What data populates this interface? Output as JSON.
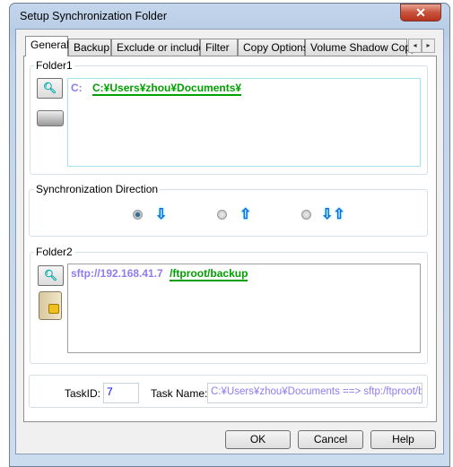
{
  "window": {
    "title": "Setup Synchronization Folder",
    "close_label": "✕"
  },
  "tabs": [
    "General",
    "Backup",
    "Exclude or include",
    "Filter",
    "Copy Options",
    "Volume Shadow Copy"
  ],
  "tab_scroll": {
    "left": "◂",
    "right": "▸"
  },
  "folder1": {
    "label": "Folder1",
    "drive": "C:",
    "path": "C:¥Users¥zhou¥Documents¥"
  },
  "sync_direction": {
    "label": "Synchronization Direction",
    "selected": 0,
    "options": [
      {
        "arrow": "⇩"
      },
      {
        "arrow": "⇧"
      },
      {
        "arrow": "⇩⇧"
      }
    ]
  },
  "folder2": {
    "label": "Folder2",
    "protocol": "sftp://192.168.41.7",
    "path": "/ftproot/backup"
  },
  "task": {
    "id_label": "TaskID:",
    "id_value": "7",
    "name_label": "Task Name:",
    "name_value": "C:¥Users¥zhou¥Documents ==> sftp:/ftproot/bac"
  },
  "buttons": {
    "ok": "OK",
    "cancel": "Cancel",
    "help": "Help"
  },
  "colors": {
    "protocol": "#8f7cf0",
    "path": "#00a000",
    "separator": "#e000e0"
  }
}
